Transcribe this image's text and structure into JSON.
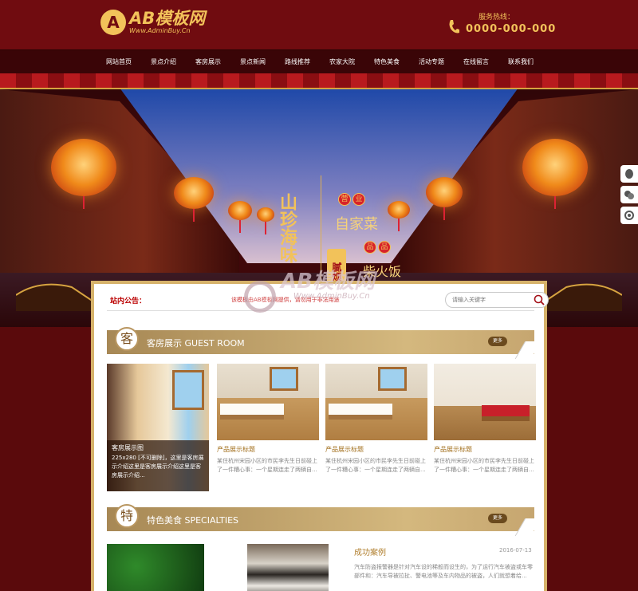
{
  "header": {
    "logo_mark": "A",
    "logo_name": "AB模板网",
    "logo_url": "Www.AdminBuy.Cn",
    "hotline_label": "服务热线：",
    "hotline_number": "0000-000-000"
  },
  "nav": {
    "items": [
      "网站首页",
      "景点介绍",
      "客房展示",
      "景点新闻",
      "路线推荐",
      "农家大院",
      "特色美食",
      "活动专题",
      "在线留言",
      "联系我们"
    ]
  },
  "banner": {
    "shanzhen": "山珍海味",
    "homemade": "自家菜",
    "chaihuo": "柴火饭",
    "scroll": "腻烦了",
    "badge1": "营",
    "badge2": "业",
    "badge3": "品",
    "badge4": "品"
  },
  "notice": {
    "label": "站内公告：",
    "text": "该模板由AB模板网提供，请勿用于非法用途"
  },
  "search": {
    "placeholder": "请输入关键字"
  },
  "rooms_section": {
    "icon_char": "客",
    "title": "客房展示 GUEST ROOM",
    "more": "更多"
  },
  "rooms": [
    {
      "name": "客房展示图",
      "desc": "225x280 [不可删除]，这里是客房展示介绍这里是客房展示介绍这里是客房展示介绍..."
    },
    {
      "name": "产品展示标题",
      "desc": "某住杭州宋园小区的市民李先生日前碰上了一件糟心事：一个星期连走了两辆自..."
    },
    {
      "name": "产品展示标题",
      "desc": "某住杭州宋园小区的市民李先生日前碰上了一件糟心事：一个星期连走了两辆自..."
    },
    {
      "name": "产品展示标题",
      "desc": "某住杭州宋园小区的市民李先生日前碰上了一件糟心事：一个星期连走了两辆自..."
    }
  ],
  "food_section": {
    "icon_char": "特",
    "title": "特色美食 SPECIALTIES",
    "more": "更多"
  },
  "case": {
    "title": "成功案例",
    "date": "2016-07-13",
    "desc": "汽车防盗报警器是针对汽车设的稀般而设生的，为了运行汽车被盗或车零部件和：汽车导被拉扯、警电池等及车内物品的被盗，人们就想着给..."
  },
  "watermark": {
    "text": "AB模板网",
    "sub": "Www.AdminBuy.Cn"
  },
  "colors": {
    "header_bg": "#700c10",
    "nav_bg": "#3a0507",
    "gold": "#f2c25a",
    "section_bar": "#c6a670"
  }
}
